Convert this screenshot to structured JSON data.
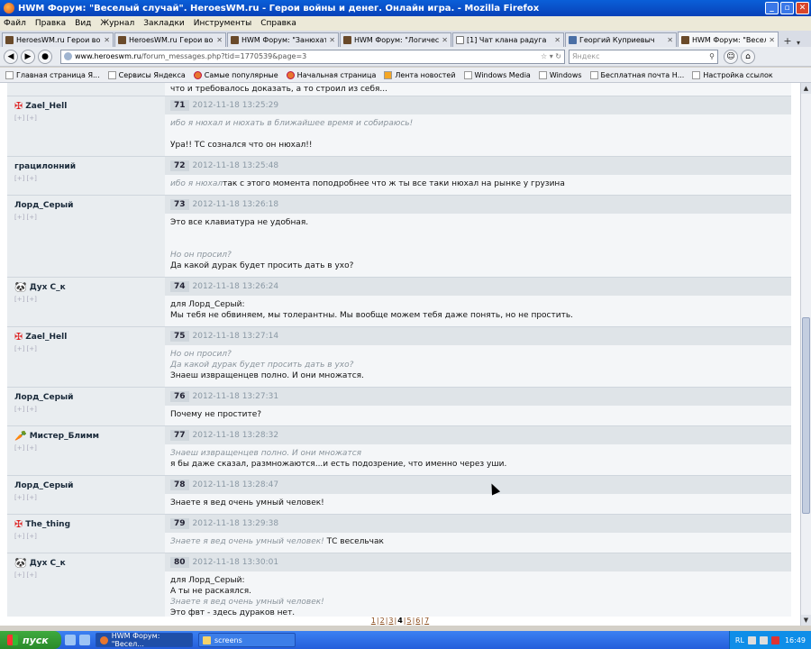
{
  "window": {
    "title": "HWM Форум: \"Веселый случай\". HeroesWM.ru - Герои войны и денег. Онлайн игра. - Mozilla Firefox"
  },
  "menu": [
    "Файл",
    "Правка",
    "Вид",
    "Журнал",
    "Закладки",
    "Инструменты",
    "Справка"
  ],
  "tabs": [
    {
      "label": "HeroesWM.ru Герои войн...",
      "icon": "game-icon"
    },
    {
      "label": "HeroesWM.ru Герои войн...",
      "icon": "game-icon"
    },
    {
      "label": "HWM Форум: \"Занюхать\" ...",
      "icon": "game-icon"
    },
    {
      "label": "HWM Форум: \"Логическо...",
      "icon": "game-icon"
    },
    {
      "label": "[1] Чат клана радуга",
      "icon": "doc-icon"
    },
    {
      "label": "Георгий Куприевыч",
      "icon": "vk-icon"
    },
    {
      "label": "HWM Форум: \"Веселый с...",
      "icon": "game-icon",
      "active": true
    }
  ],
  "address": {
    "domain": "www.heroeswm.ru",
    "path": "/forum_messages.php?tid=1770539&page=3"
  },
  "search": {
    "placeholder": "Яндекс"
  },
  "bookmarks": [
    "Главная страница Я...",
    "Сервисы Яндекса",
    "Самые популярные",
    "Начальная страница",
    "Лента новостей",
    "Windows Media",
    "Windows",
    "Бесплатная почта Н...",
    "Настройка ссылок"
  ],
  "top_fragment": "что и требовалось доказать, а то строил из себя...",
  "posts": [
    {
      "user": "Zael_Hell",
      "icon": "red",
      "stat": "[+] [+]",
      "num": "71",
      "date": "2012-11-18 13:25:29",
      "lines": [
        {
          "t": "ибо я нюхал и нюхать в ближайшее время и собираюсь!",
          "q": true
        },
        {
          "t": "",
          "gap": true
        },
        {
          "t": "Ура!! ТС сознался что он нюхал!!"
        }
      ]
    },
    {
      "user": "грацилонний",
      "icon": "",
      "stat": "[+] [+]",
      "num": "72",
      "date": "2012-11-18 13:25:48",
      "lines": [
        {
          "t": "ибо я нюхал",
          "q": true,
          "rest": "так с этого момента поподробнее что ж ты все таки нюхал на рынке у грузина"
        }
      ]
    },
    {
      "user": "Лорд_Серый",
      "icon": "",
      "stat": "[+] [+]",
      "num": "73",
      "date": "2012-11-18 13:26:18",
      "lines": [
        {
          "t": "Это все клавиатура не удобная."
        },
        {
          "t": "",
          "gap": true
        },
        {
          "t": "",
          "gap": true
        },
        {
          "t": "Но он просил?",
          "q": true
        },
        {
          "t": "Да какой дурак будет просить дать в ухо?"
        }
      ]
    },
    {
      "user": "Дух С_к",
      "icon": "pan",
      "stat": "[+] [+]",
      "num": "74",
      "date": "2012-11-18 13:26:24",
      "lines": [
        {
          "t": "для Лорд_Серый:"
        },
        {
          "t": "Мы тебя не обвиняем, мы толерантны. Мы вообще можем тебя даже понять, но не простить."
        }
      ]
    },
    {
      "user": "Zael_Hell",
      "icon": "red",
      "stat": "[+] [+]",
      "num": "75",
      "date": "2012-11-18 13:27:14",
      "lines": [
        {
          "t": "Но он просил?",
          "q": true
        },
        {
          "t": "Да какой дурак будет просить дать в ухо?",
          "q": true
        },
        {
          "t": "Знаеш извращенцев полно. И они множатся."
        }
      ]
    },
    {
      "user": "Лорд_Серый",
      "icon": "",
      "stat": "[+] [+]",
      "num": "76",
      "date": "2012-11-18 13:27:31",
      "lines": [
        {
          "t": "Почему не простите?"
        }
      ]
    },
    {
      "user": "Мистер_Блимм",
      "icon": "orange",
      "stat": "[+] [+]",
      "num": "77",
      "date": "2012-11-18 13:28:32",
      "lines": [
        {
          "t": "Знаеш извращенцев полно. И они множатся",
          "q": true
        },
        {
          "t": "я бы даже сказал, размножаются...и есть подозрение, что именно через уши."
        }
      ]
    },
    {
      "user": "Лорд_Серый",
      "icon": "",
      "stat": "[+] [+]",
      "num": "78",
      "date": "2012-11-18 13:28:47",
      "lines": [
        {
          "t": "Знаете я вед очень умный человек!"
        }
      ]
    },
    {
      "user": "The_thing",
      "icon": "red",
      "stat": "[+] [+]",
      "num": "79",
      "date": "2012-11-18 13:29:38",
      "lines": [
        {
          "t": "Знаете я вед очень умный человек!",
          "q": true,
          "rest": " ТС весельчак"
        }
      ]
    },
    {
      "user": "Дух С_к",
      "icon": "pan",
      "stat": "[+] [+]",
      "num": "80",
      "date": "2012-11-18 13:30:01",
      "lines": [
        {
          "t": "для Лорд_Серый:"
        },
        {
          "t": "А ты не раскаялся."
        },
        {
          "t": "Знаете я вед очень умный человек!",
          "q": true
        },
        {
          "t": "Это фвт - здесь дураков нет."
        }
      ]
    }
  ],
  "pager": {
    "pages": [
      "1",
      "2",
      "3",
      "4",
      "5",
      "6",
      "7"
    ],
    "current": "4"
  },
  "taskbar": {
    "start": "пуск",
    "tasks": [
      "HWM Форум: \"Весел...",
      "screens"
    ],
    "lang": "RL",
    "clock": "16:49"
  }
}
